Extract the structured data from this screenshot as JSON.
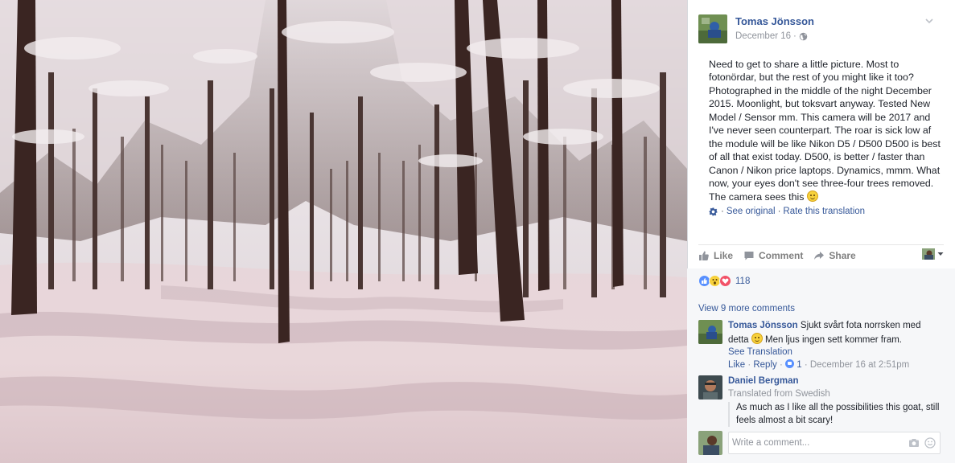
{
  "post": {
    "author": "Tomas Jönsson",
    "date": "December 16",
    "date_separator": "·",
    "audience_icon": "globe-icon",
    "text_parts": [
      "Need to get to share a little picture. Most to fotonördar, but the rest of you might like it too? Photographed in the middle of the night December 2015. Moonlight, but toksvart anyway. Tested New Model / Sensor mm. This camera will be 2017 and I've never seen counterpart. The roar is sick low af the module will be like Nikon D5 / D500 D500 is best of all that exist today. D500, is better / faster than Canon / Nikon price laptops. Dynamics, mmm. What now, your eyes don't see three-four trees removed. The camera sees this",
      ""
    ],
    "translation": {
      "sep1": "·",
      "see_original": "See original",
      "sep2": "·",
      "rate": "Rate this translation"
    }
  },
  "actions": {
    "like": "Like",
    "comment": "Comment",
    "share": "Share"
  },
  "reactions": {
    "types": [
      "like",
      "wow",
      "love"
    ],
    "count": "118"
  },
  "comments": {
    "view_more": "View 9 more comments",
    "items": [
      {
        "author": "Tomas Jönsson",
        "text_a": "Sjukt svårt fota norrsken med detta",
        "text_b": "Men ljus ingen sett kommer fram.",
        "see_translation": "See Translation",
        "like": "Like",
        "sep1": "·",
        "reply": "Reply",
        "sep2": "·",
        "likes": "1",
        "sep3": "·",
        "timestamp": "December 16 at 2:51pm"
      },
      {
        "author": "Daniel Bergman",
        "translated_from": "Translated from Swedish",
        "text": "As much as I like all the possibilities this goat, still feels almost a bit scary!"
      }
    ]
  },
  "write_comment": {
    "placeholder": "Write a comment..."
  },
  "colors": {
    "link": "#365899",
    "meta": "#90949c",
    "background_band": "#f6f7f9",
    "like_blue": "#5890ff",
    "love_red": "#f25268",
    "wow_yellow": "#f7d13c"
  }
}
